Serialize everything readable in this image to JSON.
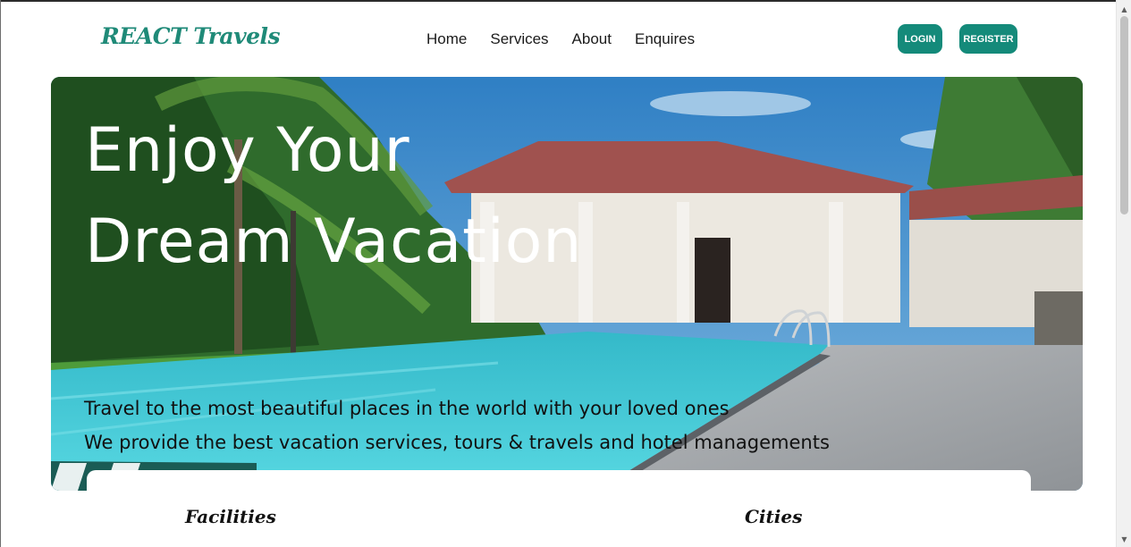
{
  "header": {
    "logo": "REACT Travels",
    "nav": [
      "Home",
      "Services",
      "About",
      "Enquires"
    ],
    "login_label": "LOGIN",
    "register_label": "REGISTER"
  },
  "hero": {
    "title_line1": "Enjoy Your",
    "title_line2": "Dream Vacation",
    "text_line1": "Travel to the most beautiful places in the world with your loved ones",
    "text_line2": "We provide the best vacation services, tours & travels and hotel managements"
  },
  "sections": {
    "facilities": "Facilities",
    "cities": "Cities"
  },
  "colors": {
    "brand": "#148a7a",
    "logo": "#1f8a78"
  },
  "icons": {
    "scroll_up": "arrow-up",
    "scroll_down": "arrow-down"
  }
}
